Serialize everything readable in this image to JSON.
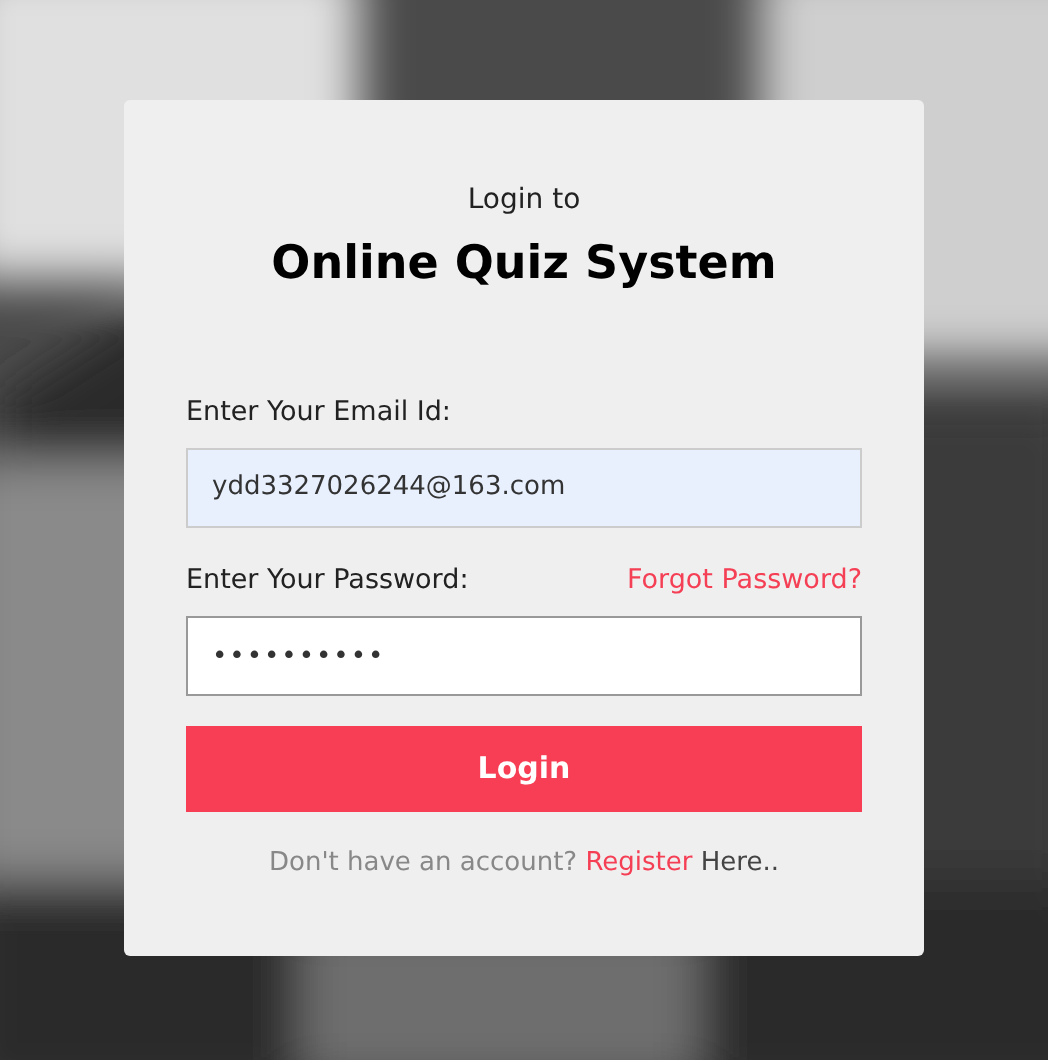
{
  "login_card": {
    "subtitle": "Login to",
    "title": "Online Quiz System",
    "email": {
      "label": "Enter Your Email Id:",
      "value": "ydd3327026244@163.com",
      "autofilled": true
    },
    "password": {
      "label": "Enter Your Password:",
      "forgot_link": "Forgot Password?",
      "value": "••••••••••"
    },
    "login_button": "Login",
    "footer": {
      "prefix": "Don't have an account?",
      "link": "Register",
      "suffix": "Here.."
    }
  }
}
